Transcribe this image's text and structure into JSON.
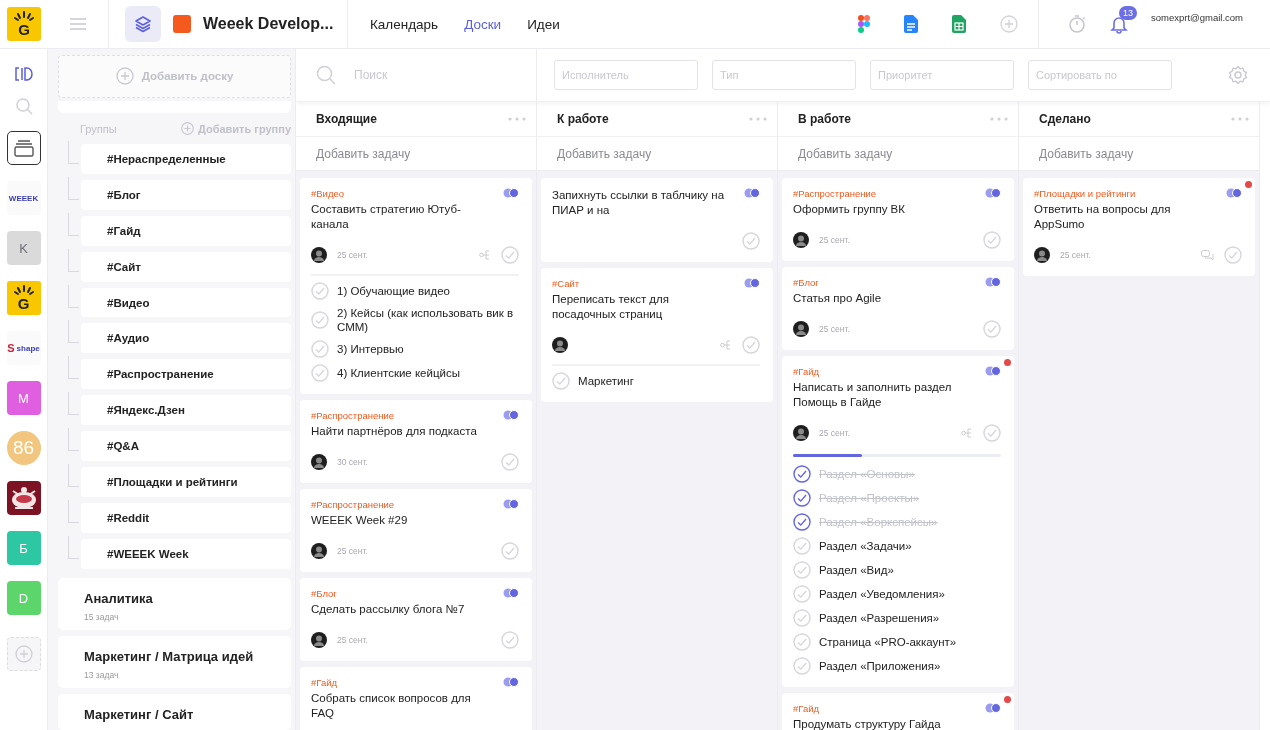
{
  "topbar": {
    "logo": {
      "label": "G"
    },
    "workspace": {
      "title": "Weeek Develop..."
    },
    "nav": [
      {
        "label": "Календарь",
        "selected": false
      },
      {
        "label": "Доски",
        "selected": true
      },
      {
        "label": "Идеи",
        "selected": false
      }
    ],
    "notifications": {
      "count": "13"
    },
    "account": {
      "email": "somexprt@gmail.com"
    }
  },
  "rail": {
    "workspaces": [
      {
        "kind": "icon",
        "selected": true
      },
      {
        "kind": "wordmark",
        "label": "WEEEK",
        "selected": false
      },
      {
        "kind": "letter",
        "label": "K",
        "color": "#dadada",
        "selected": false
      },
      {
        "kind": "g-logo",
        "label": "G",
        "color": "#f8c700",
        "selected": false
      },
      {
        "kind": "wordmark",
        "mark": "S",
        "label": "shape",
        "selected": false
      },
      {
        "kind": "letter",
        "label": "M",
        "color": "#df5fe0",
        "selected": false
      },
      {
        "kind": "round",
        "label": "86",
        "color": "#f2c67e",
        "selected": false
      },
      {
        "kind": "picture",
        "color": "#7d1322",
        "selected": false
      },
      {
        "kind": "letter",
        "label": "Б",
        "color": "#2ec7a4",
        "selected": false
      },
      {
        "kind": "letter",
        "label": "D",
        "color": "#5cd56a",
        "selected": false
      }
    ]
  },
  "sidebar": {
    "add_board": "Добавить доску",
    "groups_label": "Группы",
    "add_group": "Добавить группу",
    "groups": [
      "#Нераспределенные",
      "#Блог",
      "#Гайд",
      "#Сайт",
      "#Видео",
      "#Аудио",
      "#Распространение",
      "#Яндекс.Дзен",
      "#Q&A",
      "#Площадки и рейтинги",
      "#Reddit",
      "#WEEEK Week"
    ],
    "boards": [
      {
        "title": "Аналитика",
        "count": "15 задач"
      },
      {
        "title": "Маркетинг / Матрица идей",
        "count": "13 задач"
      },
      {
        "title": "Маркетинг / Сайт"
      }
    ]
  },
  "filters": {
    "search": {
      "placeholder": "Поиск"
    },
    "fields": [
      {
        "placeholder": "Исполнитель"
      },
      {
        "placeholder": "Тип"
      },
      {
        "placeholder": "Приоритет"
      },
      {
        "placeholder": "Сортировать по"
      }
    ]
  },
  "columns": [
    {
      "title": "Входящие",
      "add_task": "Добавить задачу",
      "cards": [
        {
          "tag": "#Видео",
          "title": "Составить стратегию Ютуб-канала",
          "assignee": true,
          "date": "25 сент.",
          "unread": false,
          "icons": [
            {
              "kind": "subtasks"
            }
          ],
          "subtasks": [
            {
              "label": "1) Обучающие видео",
              "checked": false
            },
            {
              "label": "2) Кейсы (как использовать вик в СММ)",
              "checked": false
            },
            {
              "label": "3) Интервью",
              "checked": false
            },
            {
              "label": "4) Клиентские кейцйсы",
              "checked": false
            }
          ]
        },
        {
          "tag": "#Распространение",
          "title": "Найти партнёров для подкаста",
          "assignee": true,
          "date": "30 сент.",
          "unread": false
        },
        {
          "tag": "#Распространение",
          "title": "WEEEK Week #29",
          "assignee": true,
          "date": "25 сент.",
          "unread": false
        },
        {
          "tag": "#Блог",
          "title": "Сделать рассылку блога №7",
          "assignee": true,
          "date": "25 сент.",
          "unread": false
        },
        {
          "tag": "#Гайд",
          "title": "Собрать список вопросов для FAQ",
          "unread": false
        }
      ]
    },
    {
      "title": "К работе",
      "add_task": "Добавить задачу",
      "cards": [
        {
          "title": "Запихнуть ссылки в таблчику на ПИАР и на",
          "assignee": false,
          "unread": false
        },
        {
          "tag": "#Сайт",
          "title": "Переписать текст для посадочных страниц",
          "assignee": true,
          "unread": false,
          "icons": [
            {
              "kind": "subtasks"
            }
          ],
          "subtasks": [
            {
              "label": "Маркетинг",
              "checked": false
            }
          ]
        }
      ]
    },
    {
      "title": "В работе",
      "add_task": "Добавить задачу",
      "cards": [
        {
          "tag": "#Распространение",
          "title": "Оформить группу ВК",
          "assignee": true,
          "date": "25 сент.",
          "unread": false
        },
        {
          "tag": "#Блог",
          "title": "Статья про Agile",
          "assignee": true,
          "date": "25 сент.",
          "unread": false
        },
        {
          "tag": "#Гайд",
          "title": "Написать и заполнить раздел Помощь в Гайде",
          "assignee": true,
          "date": "25 сент.",
          "unread": true,
          "icons": [
            {
              "kind": "subtasks"
            }
          ],
          "progress": {
            "level": 0.33
          },
          "subtasks": [
            {
              "label": "Раздел «Основы»",
              "checked": true
            },
            {
              "label": "Раздел «Проекты»",
              "checked": true
            },
            {
              "label": "Раздел «Воркспейсы»",
              "checked": true
            },
            {
              "label": "Раздел «Задачи»",
              "checked": false
            },
            {
              "label": "Раздел «Вид»",
              "checked": false
            },
            {
              "label": "Раздел «Уведомления»",
              "checked": false
            },
            {
              "label": "Раздел «Разрешения»",
              "checked": false
            },
            {
              "label": "Страница «PRO-аккаунт»",
              "checked": false
            },
            {
              "label": "Раздел «Приложения»",
              "checked": false
            }
          ]
        },
        {
          "tag": "#Гайд",
          "title": "Продумать структуру Гайда",
          "unread": true
        }
      ]
    },
    {
      "title": "Сделано",
      "add_task": "Добавить задачу",
      "cards": [
        {
          "tag": "#Площадки и рейтинги",
          "title": "Ответить на вопросы для AppSumo",
          "assignee": true,
          "date": "25 сент.",
          "unread": true,
          "icons": [
            {
              "kind": "comments"
            }
          ]
        }
      ]
    }
  ]
}
